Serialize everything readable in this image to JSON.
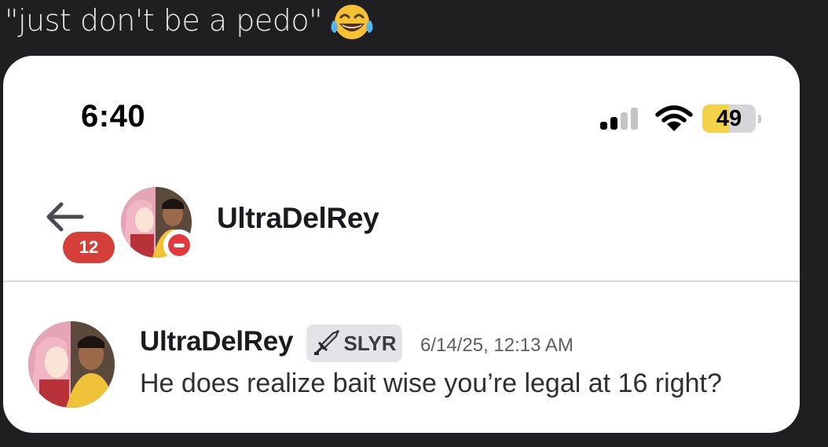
{
  "caption": {
    "text": "\"just don't be a pedo\"",
    "emoji": "face-with-tears-of-joy"
  },
  "status_bar": {
    "time": "6:40",
    "battery_percent": "49",
    "signal_bars_active": 2,
    "signal_bars_total": 4
  },
  "dm_header": {
    "unread_count": "12",
    "username": "UltraDelRey",
    "status": "do-not-disturb"
  },
  "message": {
    "author": "UltraDelRey",
    "tag": {
      "icon": "sword-icon",
      "label": "SLYR"
    },
    "timestamp": "6/14/25, 12:13 AM",
    "text": "He does realize bait wise you’re legal at 16 right?"
  },
  "colors": {
    "page_background": "#1f1f22",
    "card_background": "#ffffff",
    "unread_badge": "#d43f3a",
    "dnd_status": "#e0393e",
    "battery_fill": "#f3d24a",
    "tag_background": "#e3e4e7"
  }
}
